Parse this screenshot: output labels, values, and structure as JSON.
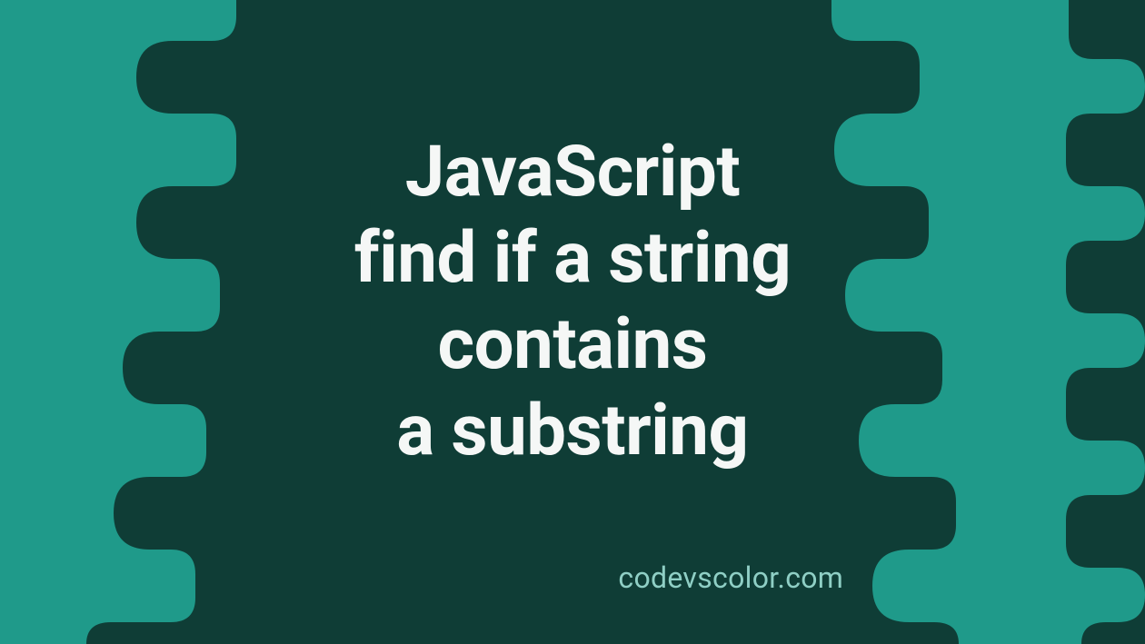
{
  "title": {
    "line1": "JavaScript",
    "line2": "find if a string",
    "line3": "contains",
    "line4": "a substring"
  },
  "attribution": "codevscolor.com",
  "colors": {
    "bg_light": "#1f9a8a",
    "bg_dark": "#0f3d36",
    "text_main": "#f5f7f6",
    "text_attr": "#8fcfc5"
  }
}
